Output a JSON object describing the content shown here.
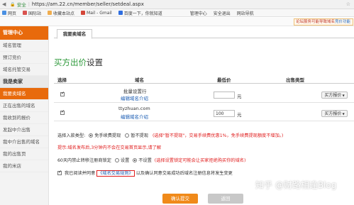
{
  "browser": {
    "security_label": "安全",
    "url": "https://am.22.cn/member/seller/setdeal.aspx"
  },
  "bookmarks": [
    {
      "label": "网页",
      "color": "#4a90e2"
    },
    {
      "label": "国际站",
      "color": "#d9534f"
    },
    {
      "label": "收藏本站点",
      "color": "#f0ad4e"
    },
    {
      "label": "Mail - Gmail",
      "color": "#d44638"
    },
    {
      "label": "百度一下，你就知道",
      "color": "#2f6ee0"
    },
    {
      "label": "管理中心",
      "color": "#e86a0c"
    },
    {
      "label": "安全退出",
      "color": "#888888"
    },
    {
      "label": "网站导航",
      "color": "#888888"
    }
  ],
  "notice": {
    "text": "论坛服务可能导致域名",
    "link": "竞价功能"
  },
  "sidebar": {
    "header": "管理中心",
    "items": [
      "域名管理",
      "预订竞价",
      "域名托管交易"
    ],
    "section": "我是卖家",
    "seller_items": [
      "我要卖域名",
      "正在出售的域名",
      "我收到的报价",
      "发起中介出售",
      "我中介出售的域名",
      "我的出售页",
      "我的米店"
    ]
  },
  "tab": {
    "label": "我要卖域名"
  },
  "page": {
    "title_highlight": "买方出价",
    "title_rest": "设置"
  },
  "table": {
    "headers": {
      "select": "选择",
      "domain": "域名",
      "min_price": "最低价",
      "sale_type": "出售类型"
    },
    "unit": "元",
    "rows": [
      {
        "domain_line1": "批量设置行",
        "domain_line2": "编辑域名介绍",
        "price": "",
        "type": "买方报价",
        "checked": true
      },
      {
        "domain_line1": "ttyzhuan.com",
        "domain_line2": "编辑域名介绍",
        "price": "100",
        "type": "买方报价",
        "checked": true
      }
    ]
  },
  "options": {
    "fee_label": "选择入款类型:",
    "fee_opt1": "免手续费提现",
    "fee_opt2": "暂不提现",
    "fee_note": "(选择\"暂不提现\"，交易手续费优惠1%，免手续费提现额度不增加。)",
    "warning": "提示:域名发布后,3分钟内不会在交易首页显示,请了解",
    "protect_label": "60天内禁止转移注册商锁定",
    "protect_opt1": "设置",
    "protect_opt2": "不设置",
    "protect_note": "(选择设置锁定可能会让买家拒绝购买你的域名)",
    "agree_prefix": "我已阅读并同意",
    "agree_link": "《域名交易规则》",
    "agree_suffix": "以及确认同意交易成功后域名注册信息将发生变更"
  },
  "buttons": {
    "submit": "确认提交",
    "back": "返回"
  },
  "watermark": "知乎 @财路相逢Blog"
}
